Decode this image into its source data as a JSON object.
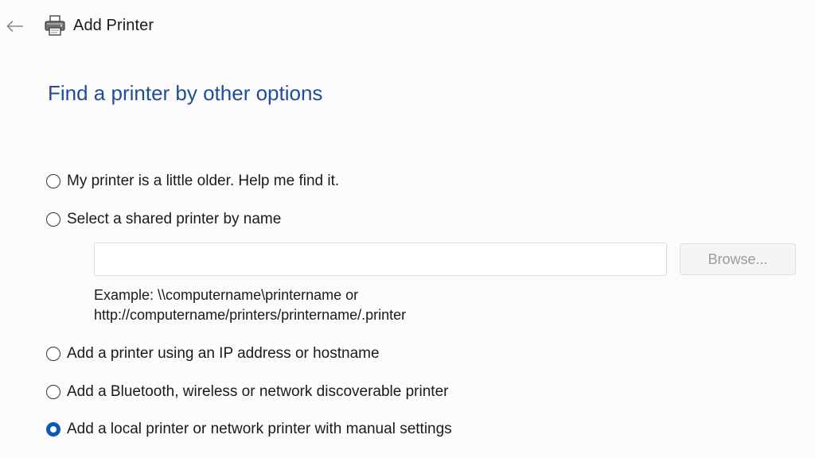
{
  "window": {
    "title": "Add Printer",
    "back_icon": "back-arrow-icon",
    "app_icon": "printer-icon"
  },
  "heading": "Find a printer by other options",
  "options": [
    {
      "label": "My printer is a little older. Help me find it.",
      "checked": false
    },
    {
      "label": "Select a shared printer by name",
      "checked": false
    },
    {
      "label": "Add a printer using an IP address or hostname",
      "checked": false
    },
    {
      "label": "Add a Bluetooth, wireless or network discoverable printer",
      "checked": false
    },
    {
      "label": "Add a local printer or network printer with manual settings",
      "checked": true
    }
  ],
  "shared_printer": {
    "input_value": "",
    "browse_label": "Browse...",
    "example_line1": "Example: \\\\computername\\printername or",
    "example_line2": "http://computername/printers/printername/.printer"
  },
  "colors": {
    "heading": "#1f4e96",
    "radio_selected": "#0a5bb5"
  }
}
